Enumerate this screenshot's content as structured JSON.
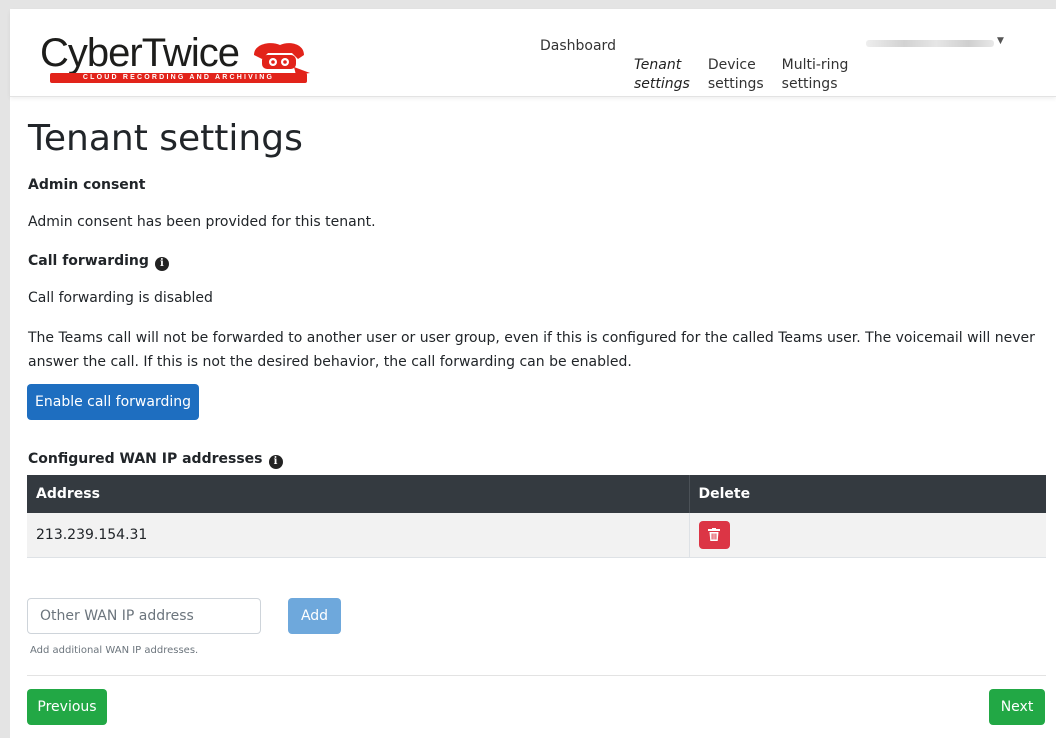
{
  "brand": {
    "name": "CyberTwice",
    "tagline": "CLOUD RECORDING AND ARCHIVING",
    "colors": {
      "accent_red": "#e2231a",
      "text": "#1d1d1b"
    }
  },
  "nav": {
    "items": [
      {
        "label": "Dashboard",
        "active": false
      },
      {
        "label": "Tenant\nsettings",
        "active": true
      },
      {
        "label": "Device\nsettings",
        "active": false
      },
      {
        "label": "Multi-ring\nsettings",
        "active": false
      }
    ],
    "user_menu_icon": "chevron-down-icon"
  },
  "page": {
    "title": "Tenant settings",
    "admin_consent": {
      "heading": "Admin consent",
      "text": "Admin consent has been provided for this tenant."
    },
    "call_forwarding": {
      "heading": "Call forwarding",
      "info_icon": "info-circle-icon",
      "status": "Call forwarding is disabled",
      "description": "The Teams call will not be forwarded to another user or user group, even if this is configured for the called Teams user. The voicemail will never answer the call. If this is not the desired behavior, the call forwarding can be enabled.",
      "button_label": "Enable call forwarding"
    },
    "wan": {
      "heading": "Configured WAN IP addresses",
      "info_icon": "info-circle-icon",
      "columns": [
        "Address",
        "Delete"
      ],
      "rows": [
        {
          "address": "213.239.154.31",
          "delete_icon": "trash-icon"
        }
      ],
      "input_placeholder": "Other WAN IP address",
      "add_label": "Add",
      "help_text": "Add additional WAN IP addresses."
    },
    "footer": {
      "previous_label": "Previous",
      "next_label": "Next"
    }
  },
  "colors": {
    "primary": "#1e6ec0",
    "add_button": "#6ea8dc",
    "success": "#22a845",
    "danger": "#dc3545",
    "table_header": "#343a40"
  }
}
